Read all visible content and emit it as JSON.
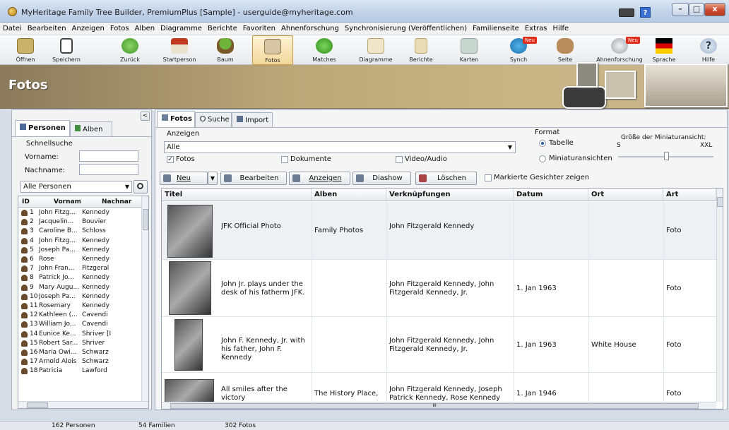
{
  "window": {
    "title": "MyHeritage Family Tree Builder, PremiumPlus [Sample] - userguide@myheritage.com",
    "controls": [
      "–",
      "□",
      "x"
    ],
    "help": "?"
  },
  "menu": [
    "Datei",
    "Bearbeiten",
    "Anzeigen",
    "Fotos",
    "Alben",
    "Diagramme",
    "Berichte",
    "Favoriten",
    "Ahnenforschung",
    "Synchronisierung (Veröffentlichen)",
    "Familienseite",
    "Extras",
    "Hilfe"
  ],
  "toolbar": {
    "items": [
      {
        "label": "Öffnen",
        "icon": "folder-icon"
      },
      {
        "label": "Speichern",
        "icon": "save-icon"
      },
      {
        "label": "Zurück",
        "icon": "back-icon"
      },
      {
        "label": "Startperson",
        "icon": "home-icon"
      },
      {
        "label": "Baum",
        "icon": "tree-icon"
      },
      {
        "label": "Fotos",
        "icon": "photos-icon"
      },
      {
        "label": "Matches",
        "icon": "matches-icon"
      },
      {
        "label": "Diagramme",
        "icon": "charts-icon"
      },
      {
        "label": "Berichte",
        "icon": "reports-icon"
      },
      {
        "label": "Karten",
        "icon": "map-icon"
      },
      {
        "label": "Synch",
        "icon": "sync-icon"
      },
      {
        "label": "Seite",
        "icon": "family-site-icon"
      },
      {
        "label": "Ahnenforschung",
        "icon": "research-icon"
      },
      {
        "label": "Sprache",
        "icon": "flag-icon"
      },
      {
        "label": "Hilfe",
        "icon": "help-icon"
      }
    ],
    "badge_new": "Neu"
  },
  "banner": {
    "title": "Fotos"
  },
  "left": {
    "tabs": [
      "Personen",
      "Alben"
    ],
    "collapse": "<",
    "quicksearch": {
      "legend": "Schnellsuche",
      "firstname_label": "Vorname:",
      "lastname_label": "Nachname:",
      "firstname_value": "",
      "lastname_value": ""
    },
    "filter": "Alle Personen",
    "columns": [
      "ID",
      "Vorname",
      "Nachnar"
    ],
    "rows": [
      {
        "id": "1",
        "first": "John Fitzg...",
        "last": "Kennedy"
      },
      {
        "id": "2",
        "first": "Jacquelin...",
        "last": "Bouvier"
      },
      {
        "id": "3",
        "first": "Caroline B...",
        "last": "Schloss"
      },
      {
        "id": "4",
        "first": "John Fitzg...",
        "last": "Kennedy"
      },
      {
        "id": "5",
        "first": "Joseph Pa...",
        "last": "Kennedy"
      },
      {
        "id": "6",
        "first": "Rose",
        "last": "Kennedy"
      },
      {
        "id": "7",
        "first": "John Fran...",
        "last": "Fitzgeral"
      },
      {
        "id": "8",
        "first": "Patrick Jo...",
        "last": "Kennedy"
      },
      {
        "id": "9",
        "first": "Mary Augu...",
        "last": "Kennedy"
      },
      {
        "id": "10",
        "first": "Joseph Pa...",
        "last": "Kennedy"
      },
      {
        "id": "11",
        "first": "Rosemary",
        "last": "Kennedy"
      },
      {
        "id": "12",
        "first": "Kathleen (...",
        "last": "Cavendi"
      },
      {
        "id": "13",
        "first": "William Jo...",
        "last": "Cavendi"
      },
      {
        "id": "14",
        "first": "Eunice Ke...",
        "last": "Shriver [I"
      },
      {
        "id": "15",
        "first": "Robert Sar...",
        "last": "Shriver"
      },
      {
        "id": "16",
        "first": "Maria Owi...",
        "last": "Schwarz"
      },
      {
        "id": "17",
        "first": "Arnold Alois",
        "last": "Schwarz"
      },
      {
        "id": "18",
        "first": "Patricia",
        "last": "Lawford"
      }
    ]
  },
  "main": {
    "tabs": [
      "Fotos",
      "Suche",
      "Import"
    ],
    "anzeigen": {
      "legend": "Anzeigen",
      "select_value": "Alle",
      "fotos": "Fotos",
      "dokumente": "Dokumente",
      "video": "Video/Audio"
    },
    "format": {
      "legend": "Format",
      "tabelle": "Tabelle",
      "miniatur": "Miniaturansichten",
      "size_label": "Größe der Miniaturansicht:",
      "size_min": "S",
      "size_max": "XXL",
      "size_level": 0.5
    },
    "buttons": {
      "neu": "Neu",
      "bearbeiten": "Bearbeiten",
      "anzeigen": "Anzeigen",
      "diashow": "Diashow",
      "loeschen": "Löschen",
      "faces": "Markierte Gesichter zeigen"
    },
    "columns": [
      "Titel",
      "Alben",
      "Verknüpfungen",
      "Datum",
      "Ort",
      "Art"
    ],
    "rows": [
      {
        "title": "JFK Official Photo",
        "album": "Family Photos",
        "links": "John Fitzgerald Kennedy",
        "date": "",
        "place": "",
        "type": "Foto"
      },
      {
        "title": "John Jr. plays under the desk of his fatherm JFK.",
        "album": "",
        "links": "John Fitzgerald Kennedy, John Fitzgerald Kennedy, Jr.",
        "date": "1. Jan 1963",
        "place": "",
        "type": "Foto"
      },
      {
        "title": "John F. Kennedy, Jr. with his father, John F. Kennedy",
        "album": "",
        "links": "John Fitzgerald Kennedy, John Fitzgerald Kennedy, Jr.",
        "date": "1. Jan 1963",
        "place": "White House",
        "type": "Foto"
      },
      {
        "title": "All smiles after the victory",
        "album": "The History Place,",
        "links": "John Fitzgerald Kennedy, Joseph Patrick Kennedy, Rose Kennedy",
        "date": "1. Jan 1946",
        "place": "",
        "type": "Foto"
      }
    ],
    "hscroll_mark": "III"
  },
  "status": {
    "persons": "162 Personen",
    "families": "54 Familien",
    "photos": "302 Fotos"
  },
  "colors": {
    "banner": "#bca779",
    "active_tool": "#f2d79a",
    "close": "#c84a2e"
  }
}
